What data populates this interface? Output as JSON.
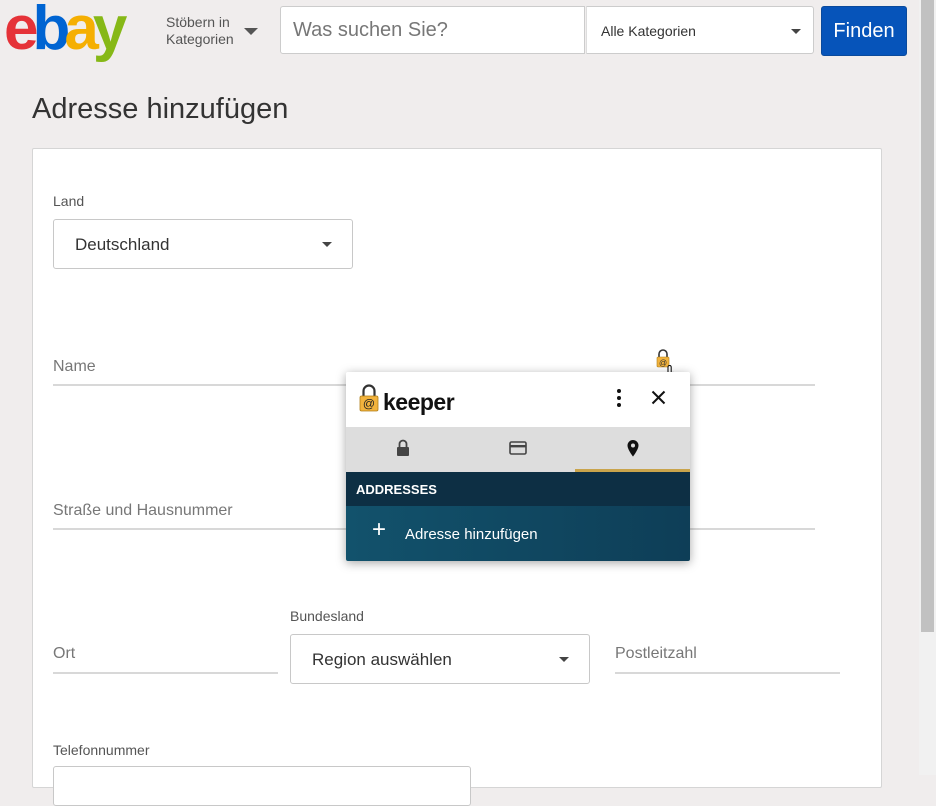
{
  "header": {
    "logo": {
      "e": "e",
      "b": "b",
      "a": "a",
      "y": "y"
    },
    "browse_line1": "Stöbern in",
    "browse_line2": "Kategorien",
    "search_placeholder": "Was suchen Sie?",
    "category_select": "Alle Kategorien",
    "find_button": "Finden"
  },
  "page": {
    "title": "Adresse hinzufügen"
  },
  "form": {
    "land_label": "Land",
    "land_value": "Deutschland",
    "name_label": "Name",
    "street_label": "Straße und Hausnummer",
    "city_label": "Ort",
    "state_label": "Bundesland",
    "state_value": "Region auswählen",
    "zip_label": "Postleitzahl",
    "phone_label": "Telefonnummer"
  },
  "keeper_popup": {
    "brand": "keeper",
    "section_header": "ADDRESSES",
    "add_plus": "+",
    "add_label": "Adresse hinzufügen",
    "tabs": [
      {
        "icon": "lock-icon"
      },
      {
        "icon": "credit-card-icon"
      },
      {
        "icon": "location-pin-icon"
      }
    ],
    "active_tab": 2
  },
  "colors": {
    "accent_blue": "#0654ba",
    "keeper_gold": "#f2b33d",
    "keeper_dark": "#0d2f44"
  }
}
